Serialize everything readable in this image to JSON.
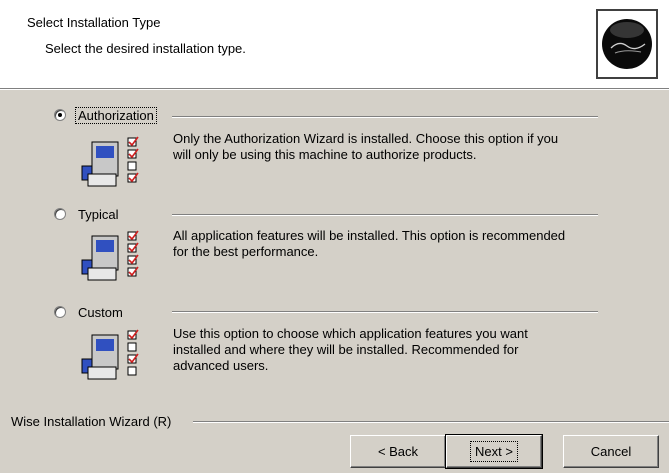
{
  "header": {
    "title": "Select Installation Type",
    "subtitle": "Select the desired installation type."
  },
  "options": [
    {
      "label": "Authorization",
      "checked": true,
      "description_lines": [
        "Only the Authorization Wizard is installed. Choose this option if you",
        "will only be using this machine to authorize products."
      ],
      "icon": "installer-features-icon"
    },
    {
      "label": "Typical",
      "checked": false,
      "description_lines": [
        "All application features will be installed. This option is recommended",
        "for the best performance."
      ],
      "icon": "installer-features-icon"
    },
    {
      "label": "Custom",
      "checked": false,
      "description_lines": [
        "Use this option to choose which application features you want",
        "installed and where they will be installed. Recommended for",
        "advanced users."
      ],
      "icon": "installer-features-icon"
    }
  ],
  "footer": {
    "brand": "Wise Installation Wizard (R)"
  },
  "buttons": {
    "back": "< Back",
    "next": "Next >",
    "cancel": "Cancel"
  }
}
